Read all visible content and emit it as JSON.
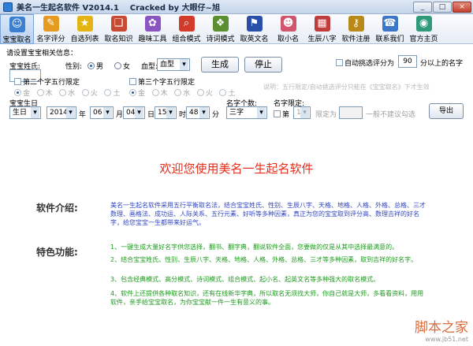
{
  "window": {
    "title": "美名一生起名软件 V2014.1    Cracked by 大眼仔~旭",
    "buttons": [
      "_",
      "□",
      "×"
    ]
  },
  "toolbar": {
    "items": [
      {
        "label": "宝宝取名",
        "icon": "baby-icon",
        "color": "#3b7fd0",
        "glyph": "☺"
      },
      {
        "label": "名字评分",
        "icon": "score-icon",
        "color": "#e59b21",
        "glyph": "✎"
      },
      {
        "label": "自选列表",
        "icon": "star-icon",
        "color": "#e3b412",
        "glyph": "★"
      },
      {
        "label": "取名知识",
        "icon": "book-icon",
        "color": "#c74a32",
        "glyph": "❑"
      },
      {
        "label": "趣味工具",
        "icon": "paint-icon",
        "color": "#8a55c2",
        "glyph": "✿"
      },
      {
        "label": "组合模式",
        "icon": "search-icon",
        "color": "#d23a2a",
        "glyph": "⌕"
      },
      {
        "label": "诗词模式",
        "icon": "scroll-icon",
        "color": "#5b8f2f",
        "glyph": "❖"
      },
      {
        "label": "取英文名",
        "icon": "flag-icon",
        "color": "#2a4fa8",
        "glyph": "⚑"
      },
      {
        "label": "取小名",
        "icon": "person-icon",
        "color": "#d1566d",
        "glyph": "☻"
      },
      {
        "label": "生辰八字",
        "icon": "calendar-icon",
        "color": "#c03d3d",
        "glyph": "▦"
      },
      {
        "label": "软件注册",
        "icon": "key-icon",
        "color": "#b98a1a",
        "glyph": "⚷"
      },
      {
        "label": "联系我们",
        "icon": "contact-icon",
        "color": "#3c77c7",
        "glyph": "☎"
      },
      {
        "label": "官方主页",
        "icon": "globe-icon",
        "color": "#2f9a7a",
        "glyph": "◉"
      }
    ]
  },
  "form": {
    "header": "请设置宝宝相关信息：",
    "surname_label": "宝宝姓氏:",
    "surname_value": "",
    "gender_label": "性别:",
    "gender_male": "男",
    "gender_female": "女",
    "blood_label": "血型:",
    "blood_value": "血型",
    "generate_button": "生成",
    "stop_button": "停止",
    "auto_pick_label": "自动挑选评分为",
    "auto_pick_value": "90",
    "auto_pick_suffix": "分以上的名字",
    "second_wuxing_label": "第二个字五行限定",
    "third_wuxing_label": "第三个字五行限定",
    "wuxing": [
      "金",
      "木",
      "水",
      "火",
      "土"
    ],
    "hint": "说明：五行限定/自动挑选评分只能在《宝宝取名》下才生效",
    "birthday_label": "宝宝生日",
    "calendar_value": "生日",
    "year_value": "2014",
    "year_unit": "年",
    "month_value": "06",
    "month_unit": "月",
    "day_value": "04",
    "day_unit": "日",
    "hour_value": "15",
    "hour_unit": "时",
    "minute_value": "48",
    "minute_unit": "分",
    "name_len_label": "名字个数:",
    "name_len_value": "三字",
    "name_limit_label": "名字限定:",
    "limit_option": "第",
    "limit_pos": "1",
    "limit_for": "限定为",
    "limit_value": "",
    "limit_note": "一般不建议勾选",
    "export_button": "导出"
  },
  "content": {
    "welcome": "欢迎您使用美名一生起名软件",
    "intro_title": "软件介绍:",
    "intro_text": "美名一生起名软件采用五行平衡取名法，结合宝宝姓氏、性别、生辰八字、天格、地格、人格、外格、总格、三才数理、画格法、成功运、人际关系、五行元素、好听等多种因素，真正为您的宝宝取到评分高、数理吉祥的好名字，给您宝宝一生都带来好运气。",
    "features_title": "特色功能:",
    "features": [
      "1、一键生成大量好名字供您选择，翻书、翻字典，翻说软件全面，您要做的仅是从其中选择最满意的。",
      "2、结合宝宝姓氏、性别、生辰八字、天格、地格、人格、外格、总格、三才等多种因素，取到吉祥的好名字。",
      "3、包含经典模式、高分模式、诗词模式、组合模式、起小名、起英文名等多种强大的取名模式。",
      "4、软件上还提供各种取名知识，还有在线新华字典，所以取名无须找大师，你自己就是大师，多看看资料，用用软件，亲手给宝宝取名，为你宝宝献一件一生有意义的事。"
    ]
  },
  "watermark": {
    "main": "脚本之家",
    "sub": "www.jb51.net"
  }
}
